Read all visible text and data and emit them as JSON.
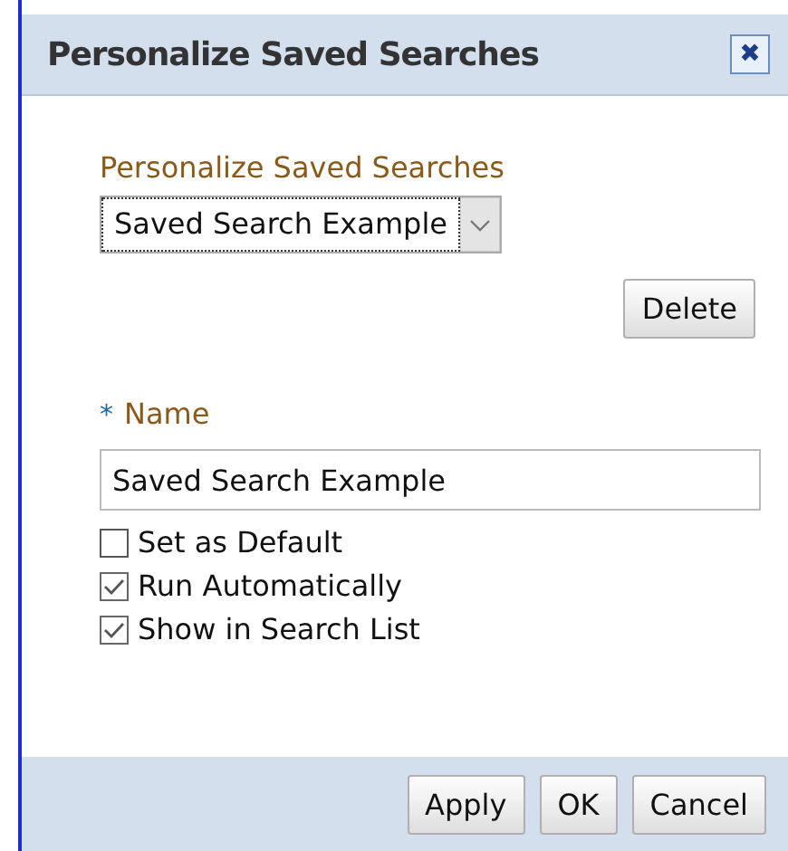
{
  "window": {
    "title": "Personalize Saved Searches",
    "close": "✖"
  },
  "saved_search": {
    "label": "Personalize Saved Searches",
    "value": "Saved Search Example"
  },
  "delete_button": "Delete",
  "name": {
    "required": "*",
    "label": "Name",
    "value": "Saved Search Example"
  },
  "options": [
    {
      "label": "Set as Default",
      "checked": false
    },
    {
      "label": "Run Automatically",
      "checked": true
    },
    {
      "label": "Show in Search List",
      "checked": true
    }
  ],
  "buttons": [
    "Apply",
    "OK",
    "Cancel"
  ]
}
